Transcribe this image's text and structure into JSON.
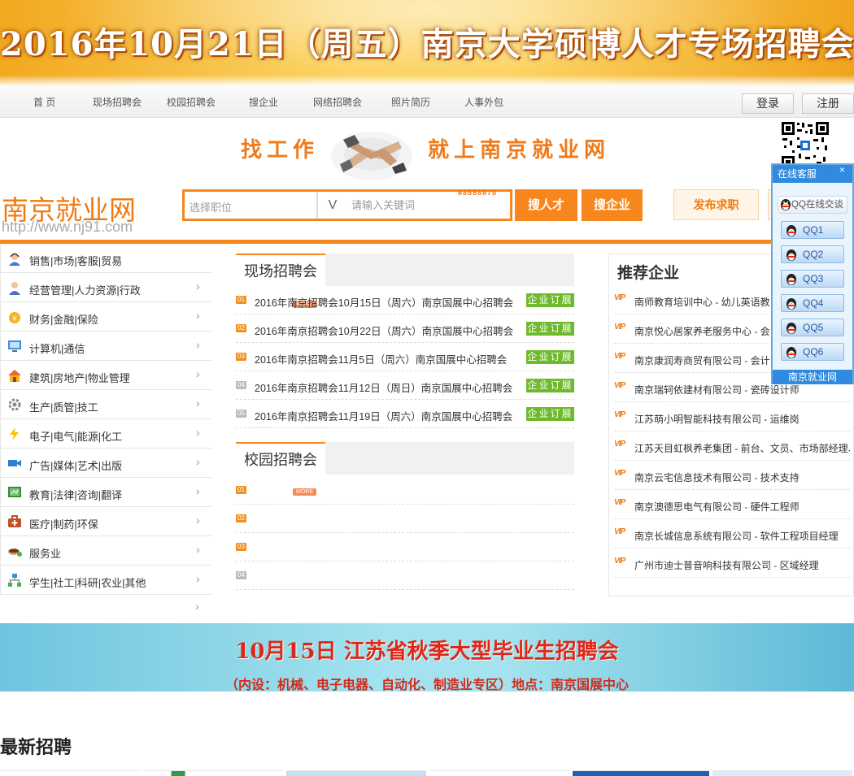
{
  "banner": {
    "title": "2016年10月21日（周五）南京大学硕博人才专场招聘会"
  },
  "nav": {
    "items": [
      "首 页",
      "现场招聘会",
      "校园招聘会",
      "搜企业",
      "网络招聘会",
      "照片简历",
      "人事外包"
    ],
    "login": "登录",
    "register": "注册"
  },
  "slogan": {
    "left": "找工作",
    "right": "就上南京就业网"
  },
  "logo": {
    "name": "南京就业网",
    "url": "http://www.nj91.com"
  },
  "search": {
    "select_placeholder": "选择职位",
    "arrow": "V",
    "keyword_placeholder": "请输入关键词",
    "phone_fragment": "88888878",
    "btn_talent": "搜人才",
    "btn_company": "搜企业",
    "btn_post": "发布求职"
  },
  "categories": [
    "销售|市场|客服|贸易",
    "经营管理|人力资源|行政",
    "财务|金融|保险",
    "计算机|通信",
    "建筑|房地产|物业管理",
    "生产|质管|技工",
    "电子|电气|能源|化工",
    "广告|媒体|艺术|出版",
    "教育|法律|咨询|翻译",
    "医疗|制药|环保",
    "服务业",
    "学生|社工|科研|农业|其他"
  ],
  "chevron": "›",
  "onsite": {
    "title": "现场招聘会",
    "more": "MORE",
    "items": [
      {
        "num": "01",
        "text": "2016年南京招聘会10月15日（周六）南京国展中心招聘会",
        "tag": "企业订展"
      },
      {
        "num": "02",
        "text": "2016年南京招聘会10月22日（周六）南京国展中心招聘会",
        "tag": "企业订展"
      },
      {
        "num": "03",
        "text": "2016年南京招聘会11月5日（周六）南京国展中心招聘会",
        "tag": "企业订展"
      },
      {
        "num": "04",
        "text": "2016年南京招聘会11月12日（周日）南京国展中心招聘会",
        "tag": "企业订展"
      },
      {
        "num": "05",
        "text": "2016年南京招聘会11月19日（周六）南京国展中心招聘会",
        "tag": "企业订展"
      }
    ]
  },
  "campus": {
    "title": "校园招聘会",
    "more": "MORE",
    "items": [
      {
        "num": "01"
      },
      {
        "num": "02"
      },
      {
        "num": "03"
      },
      {
        "num": "04"
      }
    ]
  },
  "recommend": {
    "title": "推荐企业",
    "vip": "VIP",
    "items": [
      "南师教育培训中心 - 幼儿英语教",
      "南京悦心居家养老服务中心 - 会",
      "南京康润寿商贸有限公司 - 会计",
      "南京瑞轲依建材有限公司 - 瓷砖设计师",
      "江苏萌小明智能科技有限公司 - 运维岗",
      "江苏天目虹枫养老集团 - 前台、文员、市场部经理、养",
      "南京云宅信息技术有限公司 - 技术支持",
      "南京澳德思电气有限公司 - 硬件工程师",
      "南京长城信息系统有限公司 - 软件工程项目经理",
      "广州市迪士普音响科技有限公司 - 区域经理"
    ]
  },
  "mid_banner": {
    "line1": "10月15日 江苏省秋季大型毕业生招聘会",
    "line2": "（内设：机械、电子电器、自动化、制造业专区）地点：南京国展中心"
  },
  "latest": {
    "title": "最新招聘"
  },
  "service": {
    "title": "在线客服",
    "close": "×",
    "chat": "QQ在线交谈",
    "qq": [
      "QQ1",
      "QQ2",
      "QQ3",
      "QQ4",
      "QQ5",
      "QQ6"
    ],
    "footer": "南京就业网"
  },
  "colors": {
    "accent": "#f7861c",
    "tag_green": "#6fba2c",
    "service_blue": "#2f8ae0"
  }
}
